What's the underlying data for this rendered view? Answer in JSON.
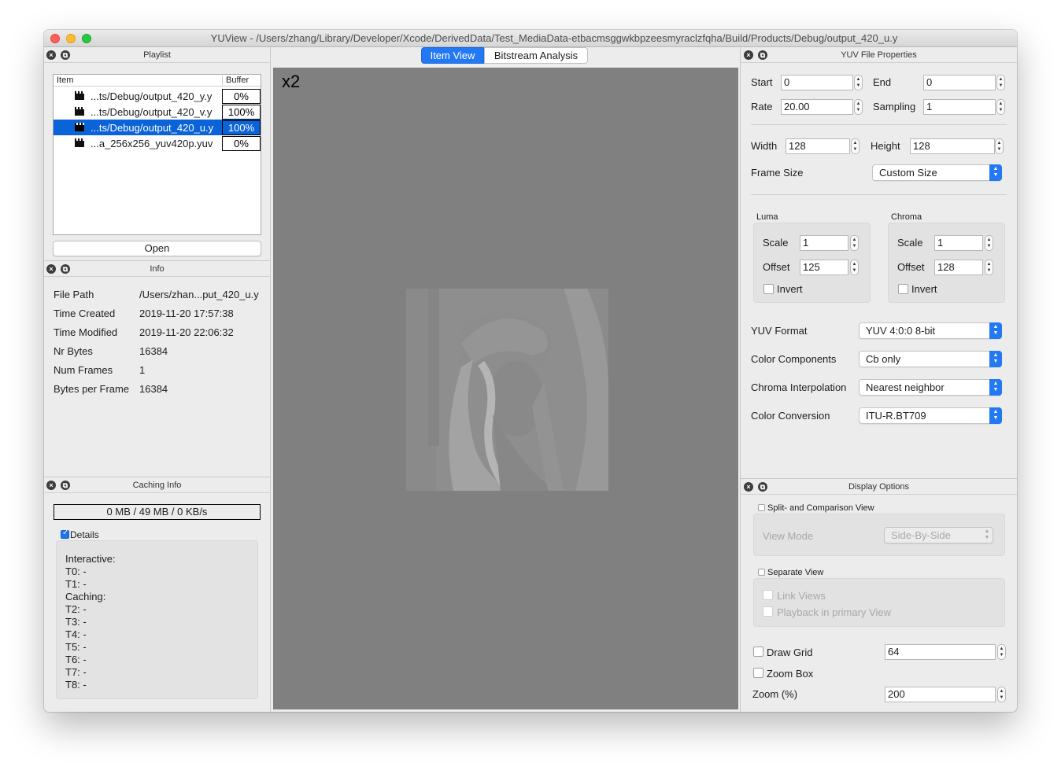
{
  "window": {
    "title": "YUView - /Users/zhang/Library/Developer/Xcode/DerivedData/Test_MediaData-etbacmsggwkbpzeesmyraclzfqha/Build/Products/Debug/output_420_u.y"
  },
  "playlist": {
    "title": "Playlist",
    "col_item": "Item",
    "col_buffer": "Buffer",
    "items": [
      {
        "name": "...ts/Debug/output_420_y.y",
        "buffer": "0%"
      },
      {
        "name": "...ts/Debug/output_420_v.y",
        "buffer": "100%"
      },
      {
        "name": "...ts/Debug/output_420_u.y",
        "buffer": "100%"
      },
      {
        "name": "...a_256x256_yuv420p.yuv",
        "buffer": "0%"
      }
    ],
    "open_label": "Open"
  },
  "info": {
    "title": "Info",
    "rows": [
      {
        "label": "File Path",
        "value": "/Users/zhan...put_420_u.y"
      },
      {
        "label": "Time Created",
        "value": "2019-11-20 17:57:38"
      },
      {
        "label": "Time Modified",
        "value": "2019-11-20 22:06:32"
      },
      {
        "label": "Nr Bytes",
        "value": "16384"
      },
      {
        "label": "Num Frames",
        "value": "1"
      },
      {
        "label": "Bytes per Frame",
        "value": "16384"
      }
    ]
  },
  "caching": {
    "title": "Caching Info",
    "status": "0 MB / 49 MB / 0 KB/s",
    "details_label": "Details",
    "lines": [
      "Interactive:",
      "T0: -",
      "T1: -",
      "Caching:",
      "T2: -",
      "T3: -",
      "T4: -",
      "T5: -",
      "T6: -",
      "T7: -",
      "T8: -"
    ]
  },
  "center": {
    "tab_item_view": "Item View",
    "tab_bitstream": "Bitstream Analysis",
    "zoom_label": "x2"
  },
  "yuv_props": {
    "title": "YUV File Properties",
    "start_label": "Start",
    "start_value": "0",
    "end_label": "End",
    "end_value": "0",
    "rate_label": "Rate",
    "rate_value": "20.00",
    "sampling_label": "Sampling",
    "sampling_value": "1",
    "width_label": "Width",
    "width_value": "128",
    "height_label": "Height",
    "height_value": "128",
    "frame_size_label": "Frame Size",
    "frame_size_value": "Custom Size",
    "luma": {
      "title": "Luma",
      "scale_label": "Scale",
      "scale_value": "1",
      "offset_label": "Offset",
      "offset_value": "125",
      "invert_label": "Invert"
    },
    "chroma": {
      "title": "Chroma",
      "scale_label": "Scale",
      "scale_value": "1",
      "offset_label": "Offset",
      "offset_value": "128",
      "invert_label": "Invert"
    },
    "yuv_format_label": "YUV Format",
    "yuv_format_value": "YUV 4:0:0 8-bit",
    "color_components_label": "Color Components",
    "color_components_value": "Cb only",
    "chroma_interp_label": "Chroma Interpolation",
    "chroma_interp_value": "Nearest neighbor",
    "color_conversion_label": "Color Conversion",
    "color_conversion_value": "ITU-R.BT709"
  },
  "display_options": {
    "title": "Display Options",
    "split_label": "Split- and Comparison View",
    "view_mode_label": "View Mode",
    "view_mode_value": "Side-By-Side",
    "separate_label": "Separate View",
    "link_views_label": "Link Views",
    "playback_label": "Playback in primary View",
    "draw_grid_label": "Draw Grid",
    "grid_value": "64",
    "zoom_box_label": "Zoom Box",
    "zoom_label": "Zoom (%)",
    "zoom_value": "200"
  }
}
